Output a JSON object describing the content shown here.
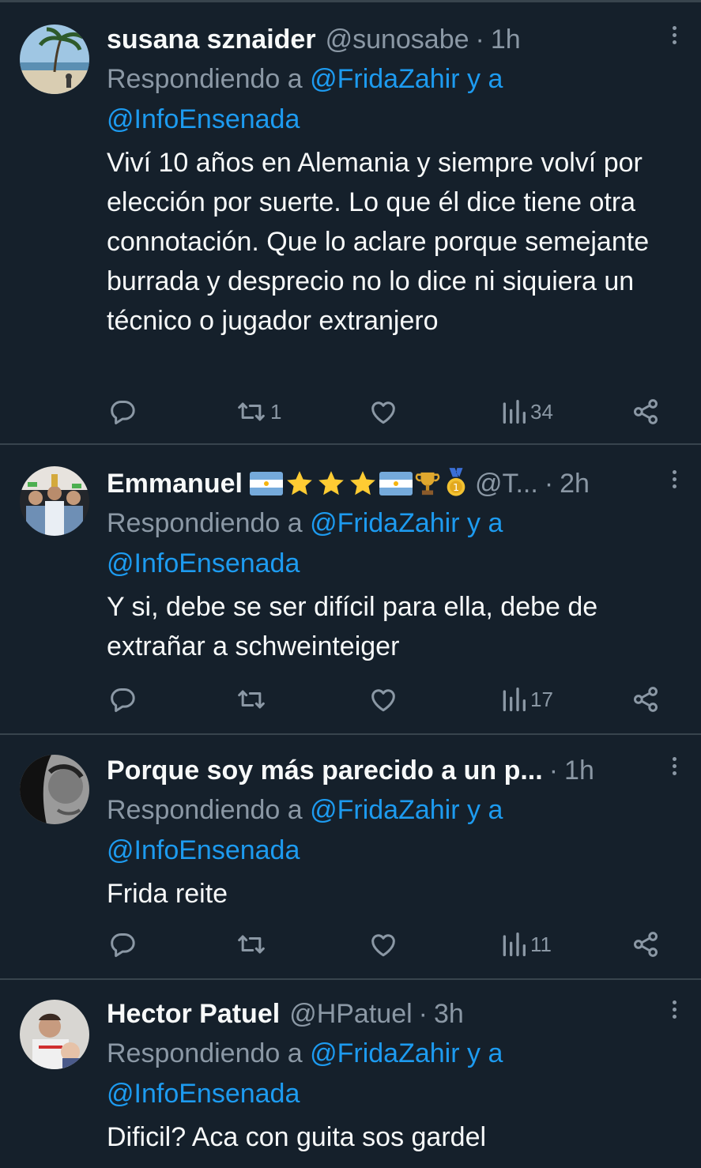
{
  "tweets": [
    {
      "name": "susana sznaider",
      "handle": "@sunosabe",
      "time": "1h",
      "reply_prefix": "Respondiendo a ",
      "mention1": "@FridaZahir",
      "reply_and": " y a",
      "mention2": "@InfoEnsenada",
      "text": "Viví 10 años en Alemania y siempre volví por elección por suerte. Lo que él dice tiene otra connotación. Que lo aclare porque semejante burrada y desprecio no lo dice ni siquiera un técnico o jugador extranjero",
      "retweets": "1",
      "views": "34"
    },
    {
      "name": "Emmanuel",
      "handle": "@T...",
      "time": "2h",
      "reply_prefix": "Respondiendo a ",
      "mention1": "@FridaZahir",
      "reply_and": " y a",
      "mention2": "@InfoEnsenada",
      "text": "Y si, debe se ser difícil para ella, debe de extrañar a schweinteiger",
      "retweets": "",
      "views": "17"
    },
    {
      "name": "Porque soy más parecido a un p...",
      "handle": "",
      "time": "1h",
      "reply_prefix": "Respondiendo a ",
      "mention1": "@FridaZahir",
      "reply_and": " y a",
      "mention2": "@InfoEnsenada",
      "text": "Frida reite",
      "retweets": "",
      "views": "11"
    },
    {
      "name": "Hector Patuel",
      "handle": "@HPatuel",
      "time": "3h",
      "reply_prefix": "Respondiendo a ",
      "mention1": "@FridaZahir",
      "reply_and": " y a",
      "mention2": "@InfoEnsenada",
      "text": "Dificil? Aca con guita sos gardel"
    }
  ],
  "colors": {
    "background": "#15202b",
    "divider": "#38444d",
    "text": "#f7f9f9",
    "secondary": "#8b98a5",
    "link": "#1d9bf0"
  },
  "icons": [
    "reply-icon",
    "retweet-icon",
    "like-icon",
    "views-icon",
    "share-icon",
    "more-icon"
  ]
}
